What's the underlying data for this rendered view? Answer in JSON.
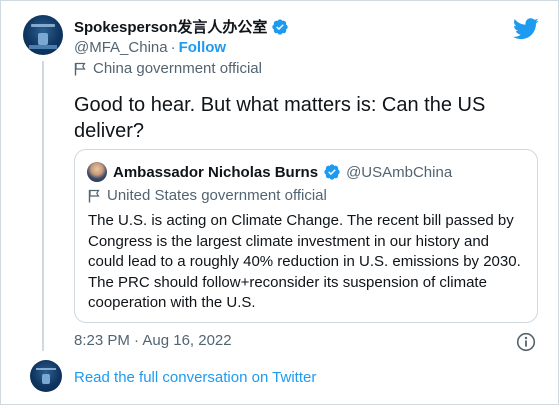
{
  "tweet": {
    "author": {
      "display_name": "Spokesperson发言人办公室",
      "handle": "@MFA_China",
      "follow_label": "Follow",
      "separator": "·",
      "label": "China government official"
    },
    "text": "Good to hear. But what matters is: Can the US deliver?",
    "quoted": {
      "display_name": "Ambassador Nicholas Burns",
      "handle": "@USAmbChina",
      "label": "United States government official",
      "text": "The U.S. is acting on Climate Change.  The recent bill passed by Congress is the largest climate investment in our history and could lead to a roughly 40% reduction in U.S. emissions by 2030. The PRC should follow+reconsider its suspension of climate cooperation with the U.S."
    },
    "timestamp": "8:23 PM · Aug 16, 2022",
    "read_conversation_label": "Read the full conversation on Twitter"
  },
  "icons": {
    "verified": "verified-badge-icon",
    "flag": "flag-icon",
    "twitter": "twitter-bird-icon",
    "info": "info-icon"
  },
  "colors": {
    "accent": "#1d9bf0",
    "text": "#0f1419",
    "muted": "#536471",
    "border": "#cfd9de"
  }
}
